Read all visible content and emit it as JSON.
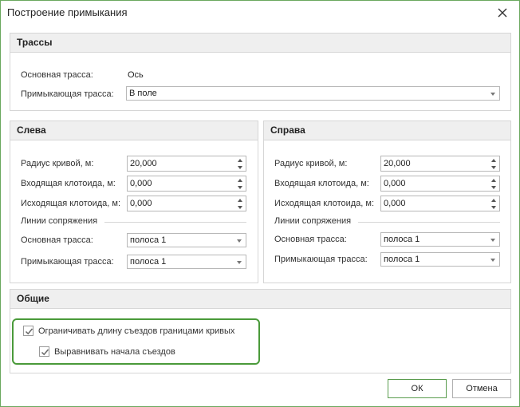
{
  "window": {
    "title": "Построение примыкания"
  },
  "tracks": {
    "header": "Трассы",
    "main_label": "Основная трасса:",
    "main_value": "Ось",
    "adjacent_label": "Примыкающая трасса:",
    "adjacent_value": "В поле"
  },
  "left": {
    "header": "Слева",
    "radius_label": "Радиус кривой, м:",
    "radius_value": "20,000",
    "in_label": "Входящая клотоида, м:",
    "in_value": "0,000",
    "out_label": "Исходящая клотоида, м:",
    "out_value": "0,000",
    "lines_label": "Линии сопряжения",
    "main_label": "Основная трасса:",
    "main_value": "полоса 1",
    "adjacent_label": "Примыкающая трасса:",
    "adjacent_value": "полоса 1"
  },
  "right": {
    "header": "Справа",
    "radius_label": "Радиус кривой, м:",
    "radius_value": "20,000",
    "in_label": "Входящая клотоида, м:",
    "in_value": "0,000",
    "out_label": "Исходящая клотоида, м:",
    "out_value": "0,000",
    "lines_label": "Линии сопряжения",
    "main_label": "Основная трасса:",
    "main_value": "полоса 1",
    "adjacent_label": "Примыкающая трасса:",
    "adjacent_value": "полоса 1"
  },
  "general": {
    "header": "Общие",
    "limit_label": "Ограничивать длину съездов границами кривых",
    "limit_checked": true,
    "align_label": "Выравнивать начала съездов",
    "align_checked": true
  },
  "buttons": {
    "ok": "ОК",
    "cancel": "Отмена"
  },
  "colors": {
    "accent": "#4a9a3a",
    "header_bg": "#efefef",
    "border": "#d6d6d6"
  },
  "icons": {
    "close": "close-icon",
    "dropdown": "chevron-down-icon",
    "check": "check-icon"
  }
}
